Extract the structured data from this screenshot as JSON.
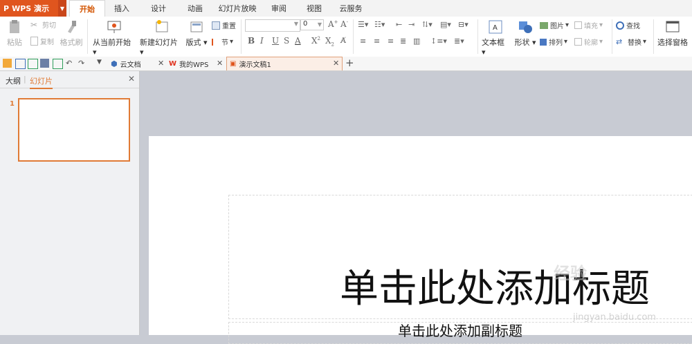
{
  "app": {
    "name": "WPS 演示"
  },
  "tabs": [
    "开始",
    "插入",
    "设计",
    "动画",
    "幻灯片放映",
    "审阅",
    "视图",
    "云服务"
  ],
  "ribbon": {
    "paste": "粘贴",
    "cut": "剪切",
    "copy": "复制",
    "format_painter": "格式刷",
    "start_from_current": "从当前开始",
    "new_slide": "新建幻灯片",
    "layout": "版式",
    "reset": "重置",
    "section": "节",
    "font_size": "0",
    "text_box": "文本框",
    "shape": "形状",
    "picture": "图片",
    "arrange": "排列",
    "fill": "填充",
    "outline": "轮廓",
    "find": "查找",
    "replace": "替换",
    "selection_pane": "选择窗格"
  },
  "doc_tabs": [
    {
      "label": "云文档"
    },
    {
      "label": "我的WPS"
    },
    {
      "label": "演示文稿1"
    }
  ],
  "panel": {
    "outline_tab": "大纲",
    "slides_tab": "幻灯片",
    "slide_number": "1"
  },
  "slide": {
    "title_placeholder": "单击此处添加标题",
    "subtitle_placeholder": "单击此处添加副标题"
  },
  "watermark": {
    "text": "经验",
    "url": "jingyan.baidu.com"
  },
  "colors": {
    "accent": "#e0551e",
    "active_tab_text": "#d35400",
    "thumb_border": "#e07a35"
  }
}
